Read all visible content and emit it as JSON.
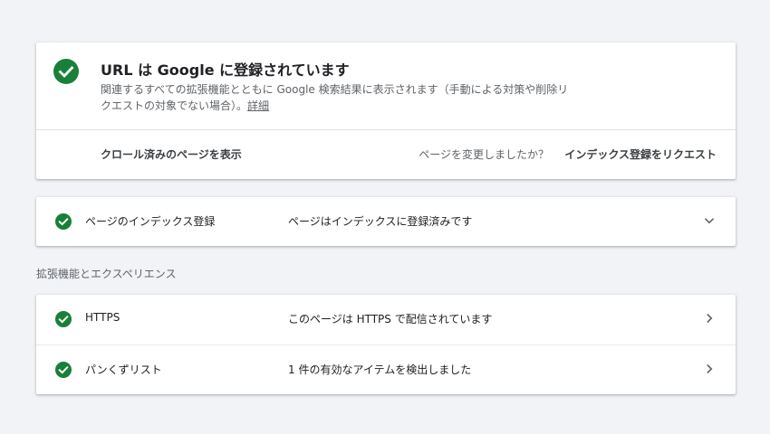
{
  "status": {
    "title": "URL は Google に登録されています",
    "description": "関連するすべての拡張機能とともに Google 検索結果に表示されます（手動による対策や削除リクエストの対象でない場合）。",
    "details_link": "詳細",
    "crawled_page_link": "クロール済みのページを表示",
    "changed_question": "ページを変更しましたか？",
    "request_indexing": "インデックス登録をリクエスト"
  },
  "index_row": {
    "label": "ページのインデックス登録",
    "value": "ページはインデックスに登録済みです"
  },
  "enhancements": {
    "heading": "拡張機能とエクスペリエンス",
    "rows": [
      {
        "label": "HTTPS",
        "value": "このページは HTTPS で配信されています"
      },
      {
        "label": "パンくずリスト",
        "value": "1 件の有効なアイテムを検出しました"
      }
    ]
  },
  "colors": {
    "success": "#188038",
    "background": "#f1f3f6",
    "card": "#ffffff"
  },
  "icons": {
    "success": "check-circle-icon",
    "expand": "chevron-down-icon",
    "navigate": "chevron-right-icon"
  }
}
